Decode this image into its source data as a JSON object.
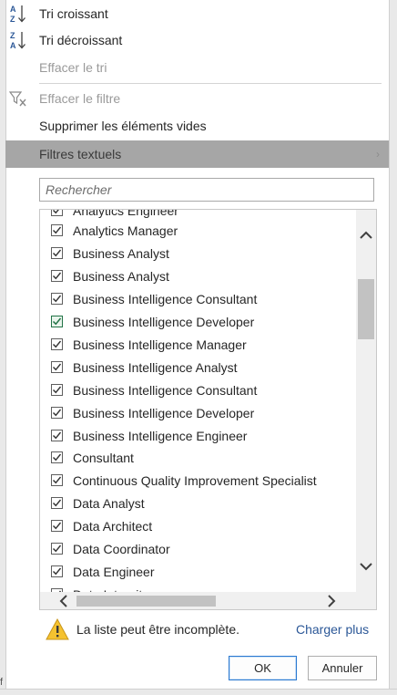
{
  "menu": {
    "sort_asc": "Tri croissant",
    "sort_desc": "Tri décroissant",
    "clear_sort": "Effacer le tri",
    "clear_filter": "Effacer le filtre",
    "remove_empty": "Supprimer les éléments vides",
    "text_filters": "Filtres textuels"
  },
  "search": {
    "placeholder": "Rechercher"
  },
  "list": {
    "partial_top": "Analytics Engineer",
    "items": [
      "Analytics Manager",
      "Business Analyst",
      "Business Analyst",
      "Business Intelligence Consultant",
      "Business Intelligence Developer",
      "Business Intelligence Manager",
      "Business Intelligence Analyst",
      "Business Intelligence Consultant",
      "Business Intelligence Developer",
      "Business Intelligence Engineer",
      "Consultant",
      "Continuous Quality Improvement Specialist",
      "Data Analyst",
      "Data Architect",
      "Data Coordinator",
      "Data Engineer"
    ],
    "partial_bottom": "Data Integrity"
  },
  "footer": {
    "warning": "La liste peut être incomplète.",
    "load_more": "Charger plus",
    "ok": "OK",
    "cancel": "Annuler"
  },
  "icons": {
    "sort_asc": "sort-a-z-icon",
    "sort_desc": "sort-z-a-icon",
    "clear_filter": "funnel-clear-icon",
    "warning": "warning-triangle-icon"
  },
  "colors": {
    "highlight": "#a6a6a6",
    "link": "#2b5797",
    "ok_border": "#2b79d0",
    "focus_check": "#217346"
  },
  "edge_char": "f"
}
